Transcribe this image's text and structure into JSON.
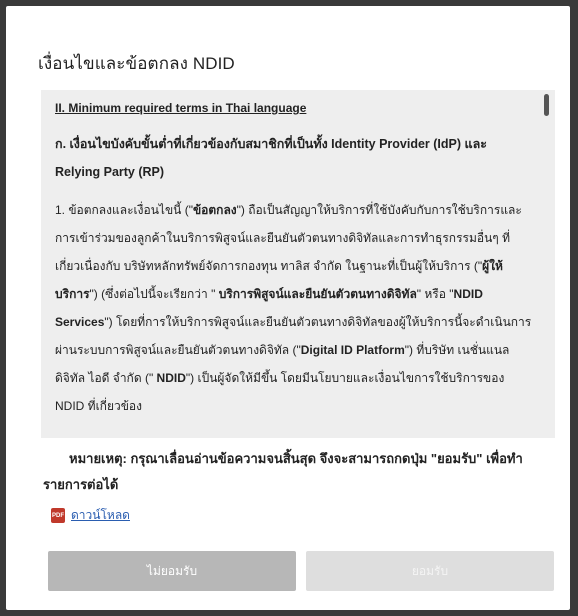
{
  "modal": {
    "title": "เงื่อนไขและข้อตกลง NDID"
  },
  "terms": {
    "heading": "II. Minimum required terms in Thai language",
    "subheading": "ก. เงื่อนไขบังคับขั้นต่ำที่เกี่ยวข้องกับสมาชิกที่เป็นทั้ง Identity Provider (IdP) และ Relying Party (RP)",
    "para_1": {
      "t1": "1. ข้อตกลงและเงื่อนไขนี้ (\"",
      "b1": "ข้อตกลง",
      "t2": "\") ถือเป็นสัญญาให้บริการที่ใช้บังคับกับการใช้บริการและการเข้าร่วมของลูกค้าในบริการพิสูจน์และยืนยันตัวตนทางดิจิทัลและการทำธุรกรรมอื่นๆ ที่เกี่ยวเนื่องกับ บริษัทหลักทรัพย์จัดการกองทุน ทาลิส จำกัด ในฐานะที่เป็นผู้ให้บริการ (\"",
      "b2": "ผู้ให้บริการ",
      "t3": "\") (ซึ่งต่อไปนี้จะเรียกว่า \" ",
      "b3": "บริการพิสูจน์และยืนยันตัวตนทางดิจิทัล",
      "t4": "\" หรือ \"",
      "b4": "NDID Services",
      "t5": "\") โดยที่การให้บริการพิสูจน์และยืนยันตัวตนทางดิจิทัลของผู้ให้บริการนี้จะดำเนินการผ่านระบบการพิสูจน์และยืนยันตัวตนทางดิจิทัล (\"",
      "b5": "Digital ID Platform",
      "t6": "\") ที่บริษัท เนชั่นแนลดิจิทัล ไอดี จำกัด (\" ",
      "b6": "NDID",
      "t7": "\") เป็นผู้จัดให้มีขึ้น โดยมีนโยบายและเงื่อนไขการใช้บริการของ NDID ที่เกี่ยวข้อง"
    }
  },
  "note": {
    "line1": "หมายเหตุ: กรุณาเลื่อนอ่านข้อความจนสิ้นสุด จึงจะสามารถกดปุ่ม \"ยอมรับ\" เพื่อทำ",
    "line2": "รายการต่อได้"
  },
  "download": {
    "icon_label": "PDF",
    "label": "ดาวน์โหลด"
  },
  "buttons": {
    "reject_label": "ไม่ยอมรับ",
    "accept_label": "ยอมรับ"
  },
  "colors": {
    "reject_bg": "#b7b7b7",
    "accept_bg_disabled": "#dedede",
    "link": "#2a5db0",
    "pdf_icon": "#c0392b"
  }
}
